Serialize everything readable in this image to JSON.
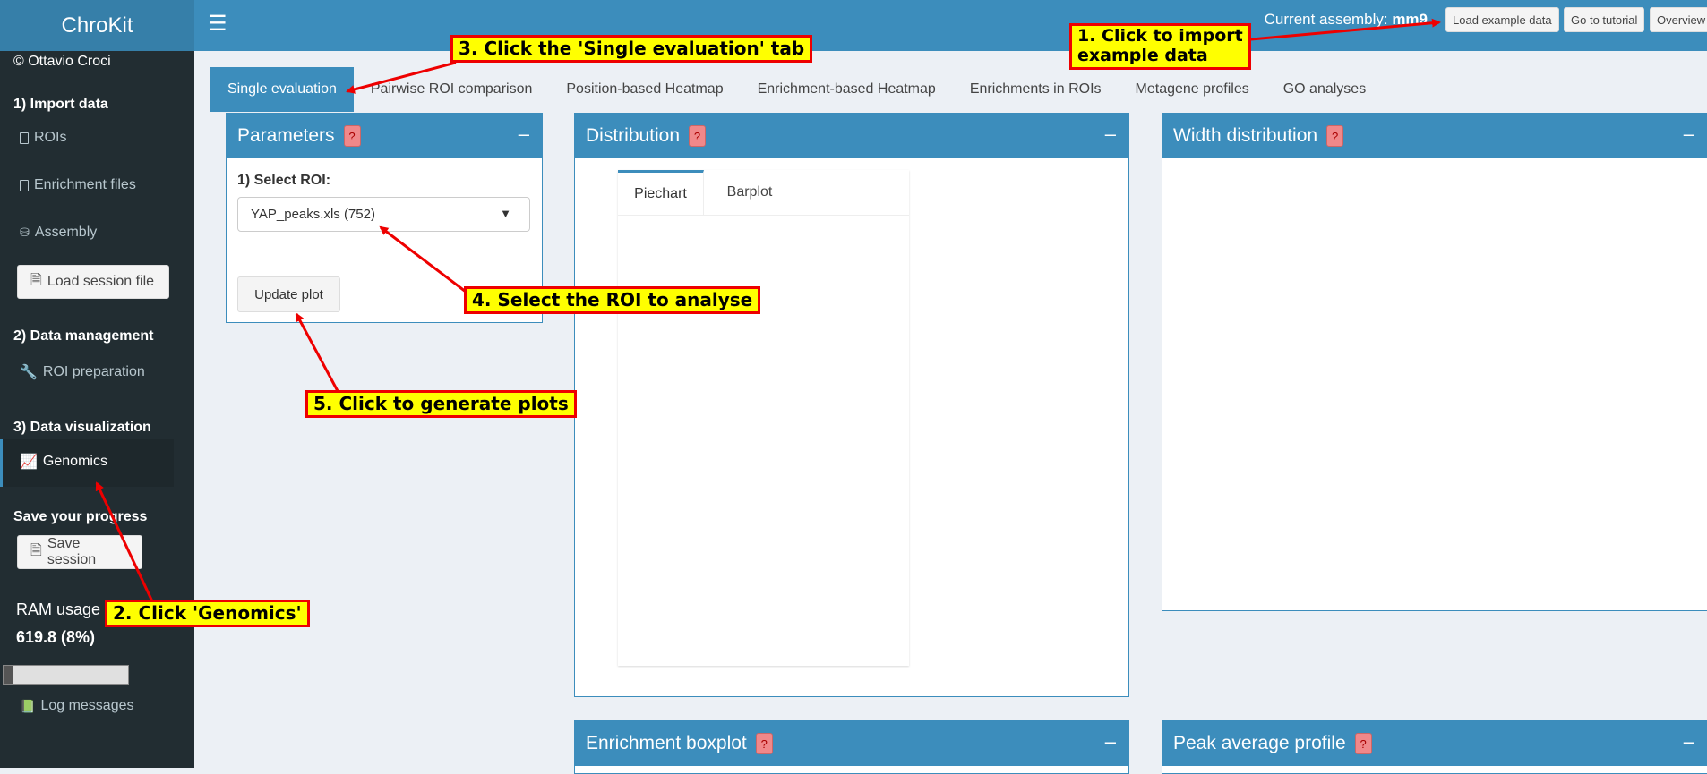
{
  "app": {
    "title": "ChroKit"
  },
  "header": {
    "assembly_label": "Current assembly:",
    "assembly_value": "mm9",
    "buttons": [
      "Load example data",
      "Go to tutorial",
      "Overview"
    ]
  },
  "sidebar": {
    "credit": "© Ottavio Croci",
    "section_import": "1) Import data",
    "items_import": [
      "ROIs",
      "Enrichment files",
      "Assembly"
    ],
    "load_session_label": "Load session file",
    "section_management": "2) Data management",
    "roi_preparation": "ROI preparation",
    "section_visualization": "3) Data visualization",
    "genomics": "Genomics",
    "save_progress": "Save your progress",
    "save_session_label": "Save session",
    "ram_label": "RAM usage (",
    "ram_value": "619.8 (8%)",
    "ram_fraction": 0.08,
    "log_messages": "Log messages"
  },
  "tabs": [
    "Single evaluation",
    "Pairwise ROI comparison",
    "Position-based Heatmap",
    "Enrichment-based Heatmap",
    "Enrichments in ROIs",
    "Metagene profiles",
    "GO analyses"
  ],
  "parameters": {
    "title": "Parameters",
    "help": "?",
    "select_label": "1) Select ROI:",
    "select_value": "YAP_peaks.xls (752)",
    "update_label": "Update plot"
  },
  "distribution": {
    "title": "Distribution",
    "help": "?",
    "tabs": [
      "Piechart",
      "Barplot"
    ]
  },
  "width_distribution": {
    "title": "Width distribution",
    "help": "?"
  },
  "enrichment_boxplot": {
    "title": "Enrichment boxplot",
    "help": "?"
  },
  "peak_average": {
    "title": "Peak average profile",
    "help": "?"
  },
  "callouts": {
    "c1_line1": "1. Click to import",
    "c1_line2": "example data",
    "c2": "2. Click 'Genomics'",
    "c3": "3. Click the 'Single evaluation' tab",
    "c4": "4. Select the ROI to analyse",
    "c5": "5. Click to generate plots"
  },
  "colors": {
    "primary": "#3c8dbc",
    "sidebar": "#222d32",
    "callout_bg": "#ffff00",
    "callout_border": "#ee0000"
  }
}
